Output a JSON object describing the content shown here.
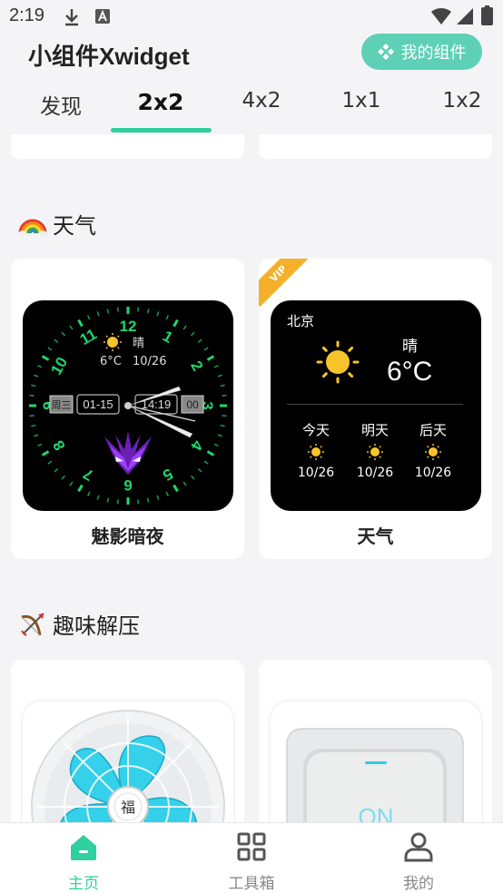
{
  "status_bar": {
    "time": "2:19"
  },
  "header": {
    "title": "小组件Xwidget",
    "my_widgets_label": "我的组件"
  },
  "tabs": [
    {
      "label": "发现"
    },
    {
      "label": "2x2"
    },
    {
      "label": "4x2"
    },
    {
      "label": "1x1"
    },
    {
      "label": "1x2"
    }
  ],
  "sections": {
    "weather": {
      "title": "天气",
      "cards": [
        {
          "label": "魅影暗夜",
          "clock": {
            "numbers": [
              "12",
              "1",
              "2",
              "3",
              "4",
              "5",
              "6",
              "7",
              "8",
              "9",
              "10",
              "11"
            ],
            "condition": "晴",
            "temp": "6°C",
            "date": "10/26",
            "weekday": "周三",
            "date_short": "01-15",
            "time": "14:19",
            "seconds": "00"
          }
        },
        {
          "label": "天气",
          "vip": "VIP",
          "weather": {
            "city": "北京",
            "condition": "晴",
            "temp": "6°C",
            "forecast": [
              {
                "day": "今天",
                "date": "10/26"
              },
              {
                "day": "明天",
                "date": "10/26"
              },
              {
                "day": "后天",
                "date": "10/26"
              }
            ]
          }
        }
      ]
    },
    "fun": {
      "title": "趣味解压",
      "cards": [
        {
          "fan_text": "福"
        },
        {
          "switch_text": "ON"
        }
      ]
    }
  },
  "bottom_nav": [
    {
      "label": "主页"
    },
    {
      "label": "工具箱"
    },
    {
      "label": "我的"
    }
  ],
  "colors": {
    "accent": "#2fcfa0",
    "button": "#5ed0b6",
    "vip": "#f4b02a",
    "clock_green": "#1fd86a"
  }
}
